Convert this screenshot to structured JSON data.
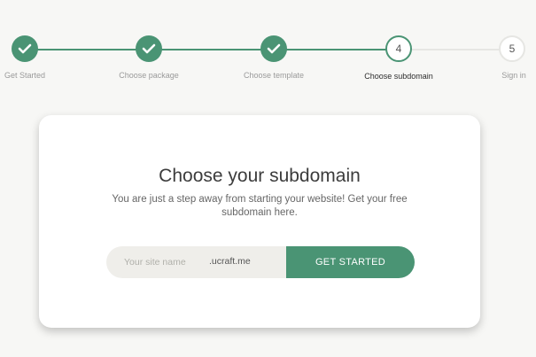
{
  "stepper": {
    "steps": [
      {
        "label": "Get Started",
        "status": "done",
        "icon": "check-icon"
      },
      {
        "label": "Choose package",
        "status": "done",
        "icon": "check-icon"
      },
      {
        "label": "Choose template",
        "status": "done",
        "icon": "check-icon"
      },
      {
        "label": "Choose subdomain",
        "status": "current",
        "number": "4"
      },
      {
        "label": "Sign in",
        "status": "todo",
        "number": "5"
      }
    ]
  },
  "card": {
    "title": "Choose your subdomain",
    "description": "You are just a step away from starting your website! Get your free subdomain here.",
    "input_placeholder": "Your site name",
    "input_suffix": ".ucraft.me",
    "button_label": "GET STARTED"
  },
  "colors": {
    "accent": "#4a9474",
    "background": "#f7f7f5",
    "card": "#ffffff",
    "input_bg": "#efeeea"
  }
}
